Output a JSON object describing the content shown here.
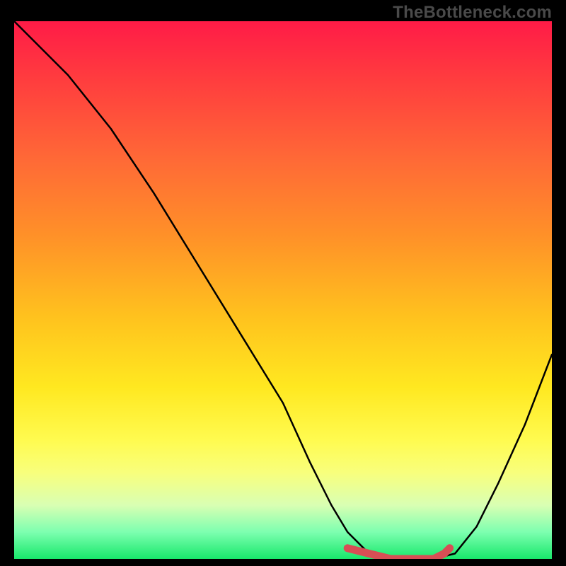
{
  "watermark": "TheBottleneck.com",
  "colors": {
    "background": "#000000",
    "watermark_text": "#4a4a4a",
    "curve": "#000000",
    "marker": "#d84e55",
    "gradient_top": "#ff1b47",
    "gradient_bottom": "#18e86b"
  },
  "chart_data": {
    "type": "line",
    "title": "",
    "xlabel": "",
    "ylabel": "",
    "xlim": [
      0,
      100
    ],
    "ylim": [
      0,
      100
    ],
    "grid": false,
    "legend": false,
    "series": [
      {
        "name": "bottleneck-curve",
        "x": [
          0,
          4,
          10,
          18,
          26,
          34,
          42,
          50,
          55,
          59,
          62,
          66,
          72,
          78,
          82,
          86,
          90,
          95,
          100
        ],
        "values": [
          100,
          96,
          90,
          80,
          68,
          55,
          42,
          29,
          18,
          10,
          5,
          1,
          0,
          0,
          1,
          6,
          14,
          25,
          38
        ]
      }
    ],
    "markers": {
      "name": "optimal-range",
      "x": [
        62,
        66,
        70,
        74,
        78,
        80,
        81
      ],
      "values": [
        2,
        1,
        0,
        0,
        0,
        1,
        2
      ]
    }
  }
}
